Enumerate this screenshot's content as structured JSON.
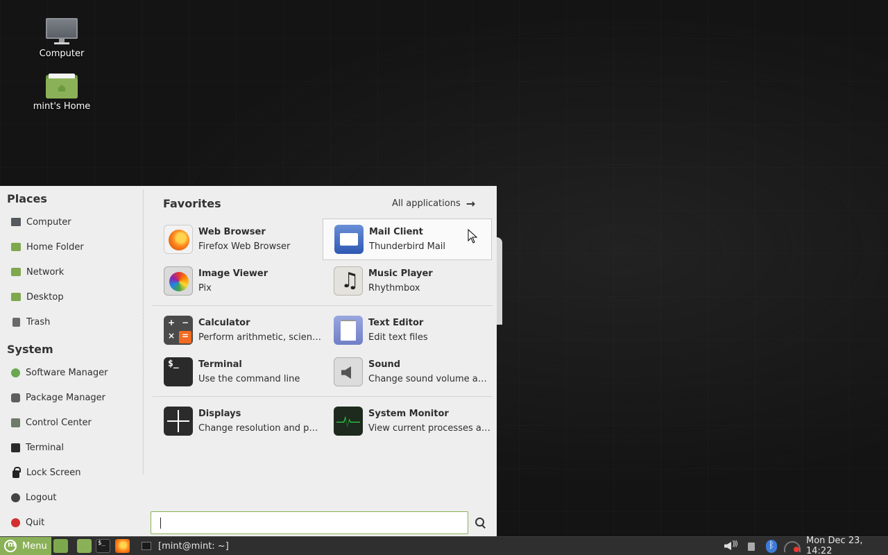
{
  "desktop": {
    "icons": [
      {
        "label": "Computer",
        "icon": "monitor-icon"
      },
      {
        "label": "mint's Home",
        "icon": "home-folder-icon"
      }
    ]
  },
  "menu": {
    "places_title": "Places",
    "places": [
      {
        "label": "Computer",
        "icon": "monitor-icon"
      },
      {
        "label": "Home Folder",
        "icon": "home-folder-icon"
      },
      {
        "label": "Network",
        "icon": "network-folder-icon"
      },
      {
        "label": "Desktop",
        "icon": "desktop-folder-icon"
      },
      {
        "label": "Trash",
        "icon": "trash-icon"
      }
    ],
    "system_title": "System",
    "system": [
      {
        "label": "Software Manager",
        "icon": "software-manager-icon"
      },
      {
        "label": "Package Manager",
        "icon": "package-manager-icon"
      },
      {
        "label": "Control Center",
        "icon": "control-center-icon"
      },
      {
        "label": "Terminal",
        "icon": "terminal-icon"
      },
      {
        "label": "Lock Screen",
        "icon": "lock-icon"
      },
      {
        "label": "Logout",
        "icon": "logout-icon"
      },
      {
        "label": "Quit",
        "icon": "power-icon"
      }
    ],
    "favorites_title": "Favorites",
    "all_applications": "All applications",
    "favorites": [
      {
        "name": "Web Browser",
        "desc": "Firefox Web Browser",
        "icon": "firefox-icon"
      },
      {
        "name": "Mail Client",
        "desc": "Thunderbird Mail",
        "icon": "mail-icon",
        "selected": true
      },
      {
        "name": "Image Viewer",
        "desc": "Pix",
        "icon": "image-viewer-icon"
      },
      {
        "name": "Music Player",
        "desc": "Rhythmbox",
        "icon": "music-icon"
      },
      {
        "name": "Calculator",
        "desc": "Perform arithmetic, scientific or financial calculations",
        "icon": "calculator-icon"
      },
      {
        "name": "Text Editor",
        "desc": "Edit text files",
        "icon": "text-editor-icon"
      },
      {
        "name": "Terminal",
        "desc": "Use the command line",
        "icon": "terminal-icon"
      },
      {
        "name": "Sound",
        "desc": "Change sound volume and sound events",
        "icon": "sound-icon"
      },
      {
        "name": "Displays",
        "desc": "Change resolution and position of monitors",
        "icon": "displays-icon"
      },
      {
        "name": "System Monitor",
        "desc": "View current processes and monitor system state",
        "icon": "system-monitor-icon"
      }
    ],
    "search": {
      "value": "",
      "placeholder": ""
    }
  },
  "panel": {
    "menu_label": "Menu",
    "launchers": [
      "show-desktop-icon",
      "files-icon",
      "terminal-icon",
      "firefox-icon"
    ],
    "task_title": "[mint@mint: ~]",
    "clock": "Mon Dec 23, 14:22"
  },
  "colors": {
    "accent": "#8bb158",
    "panel": "#2f2f2f",
    "menu_bg": "#eeeeee"
  }
}
